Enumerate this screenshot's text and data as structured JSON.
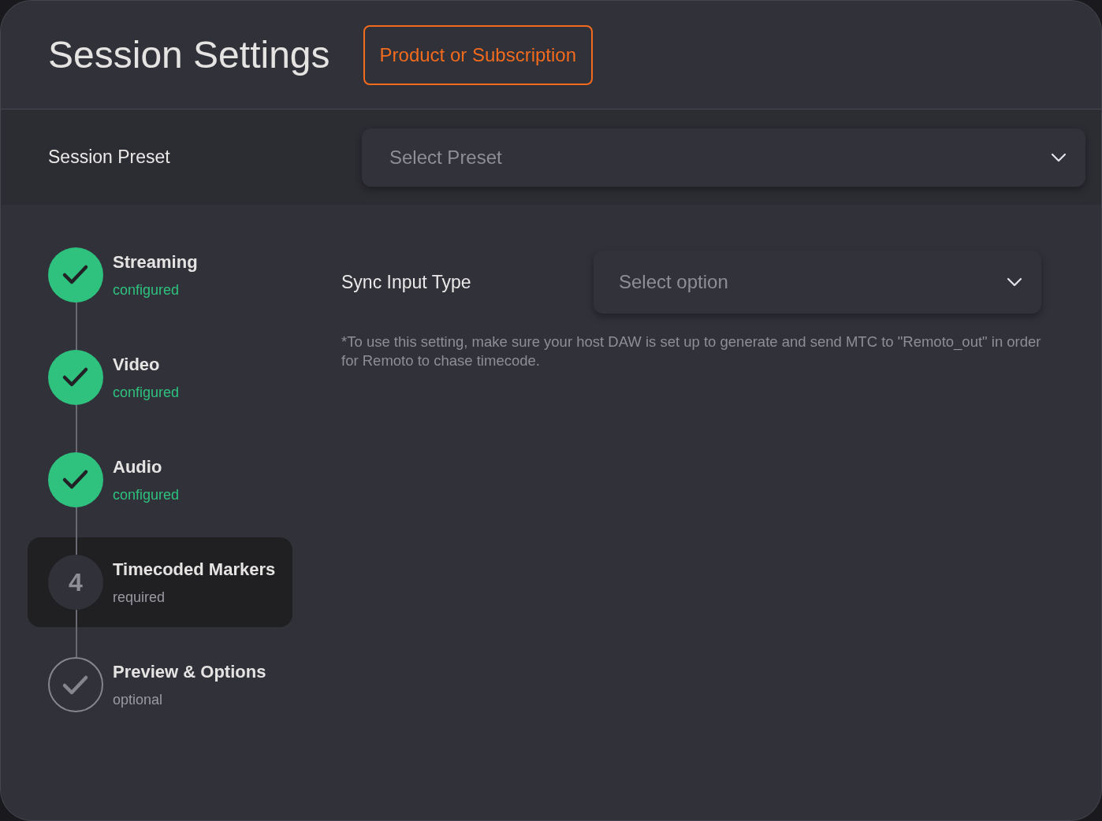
{
  "header": {
    "title": "Session Settings",
    "product_button": "Product or Subscription"
  },
  "preset": {
    "label": "Session Preset",
    "placeholder": "Select Preset"
  },
  "steps": [
    {
      "title": "Streaming",
      "status": "configured",
      "kind": "done",
      "selected": false
    },
    {
      "title": "Video",
      "status": "configured",
      "kind": "done",
      "selected": false
    },
    {
      "title": "Audio",
      "status": "configured",
      "kind": "done",
      "selected": false
    },
    {
      "title": "Timecoded Markers",
      "status": "required",
      "kind": "number",
      "number": "4",
      "selected": true
    },
    {
      "title": "Preview & Options",
      "status": "optional",
      "kind": "optional",
      "selected": false
    }
  ],
  "sync": {
    "label": "Sync Input Type",
    "placeholder": "Select option",
    "note": "*To use this setting, make sure your host DAW is set up to generate and send MTC to \"Remoto_out\" in order for Remoto to chase timecode."
  }
}
